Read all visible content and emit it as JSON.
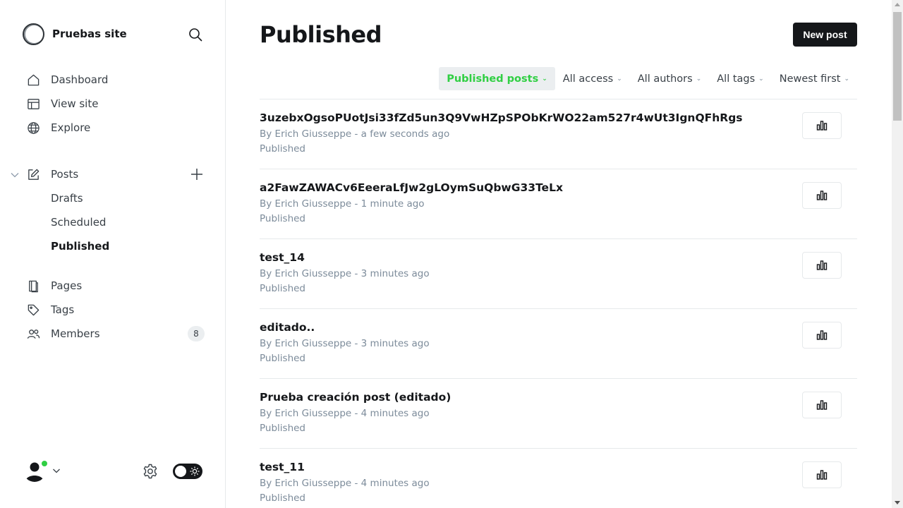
{
  "sidebar": {
    "site_name": "Pruebas site",
    "nav": [
      {
        "label": "Dashboard",
        "icon": "house-icon"
      },
      {
        "label": "View site",
        "icon": "layout-icon"
      },
      {
        "label": "Explore",
        "icon": "globe-icon"
      }
    ],
    "posts": {
      "label": "Posts",
      "icon": "pencil-square-icon",
      "sub_items": [
        {
          "label": "Drafts"
        },
        {
          "label": "Scheduled"
        },
        {
          "label": "Published",
          "active": true
        }
      ]
    },
    "nav2": [
      {
        "label": "Pages",
        "icon": "page-icon"
      },
      {
        "label": "Tags",
        "icon": "tag-icon"
      },
      {
        "label": "Members",
        "icon": "people-icon",
        "count": "8"
      }
    ]
  },
  "main": {
    "title": "Published",
    "new_post_label": "New post",
    "filters": [
      {
        "label": "Published posts",
        "active": true
      },
      {
        "label": "All access"
      },
      {
        "label": "All authors"
      },
      {
        "label": "All tags"
      },
      {
        "label": "Newest first"
      }
    ],
    "posts": [
      {
        "title": "3uzebxOgsoPUotJsi33fZd5un3Q9VwHZpSPObKrWO22am527r4wUt3IgnQFhRgs",
        "meta": "By Erich Giusseppe - a few seconds ago",
        "status": "Published"
      },
      {
        "title": "a2FawZAWACv6EeeraLfJw2gLOymSuQbwG33TeLx",
        "meta": "By Erich Giusseppe - 1 minute ago",
        "status": "Published"
      },
      {
        "title": "test_14",
        "meta": "By Erich Giusseppe - 3 minutes ago",
        "status": "Published"
      },
      {
        "title": "editado..",
        "meta": "By Erich Giusseppe - 3 minutes ago",
        "status": "Published"
      },
      {
        "title": "Prueba creación post (editado)",
        "meta": "By Erich Giusseppe - 4 minutes ago",
        "status": "Published"
      },
      {
        "title": "test_11",
        "meta": "By Erich Giusseppe - 4 minutes ago",
        "status": "Published"
      }
    ]
  },
  "colors": {
    "accent_green": "#30cf43",
    "text_dark": "#15171a",
    "text_muted": "#7c8b9a",
    "border": "#e6e9eb"
  }
}
